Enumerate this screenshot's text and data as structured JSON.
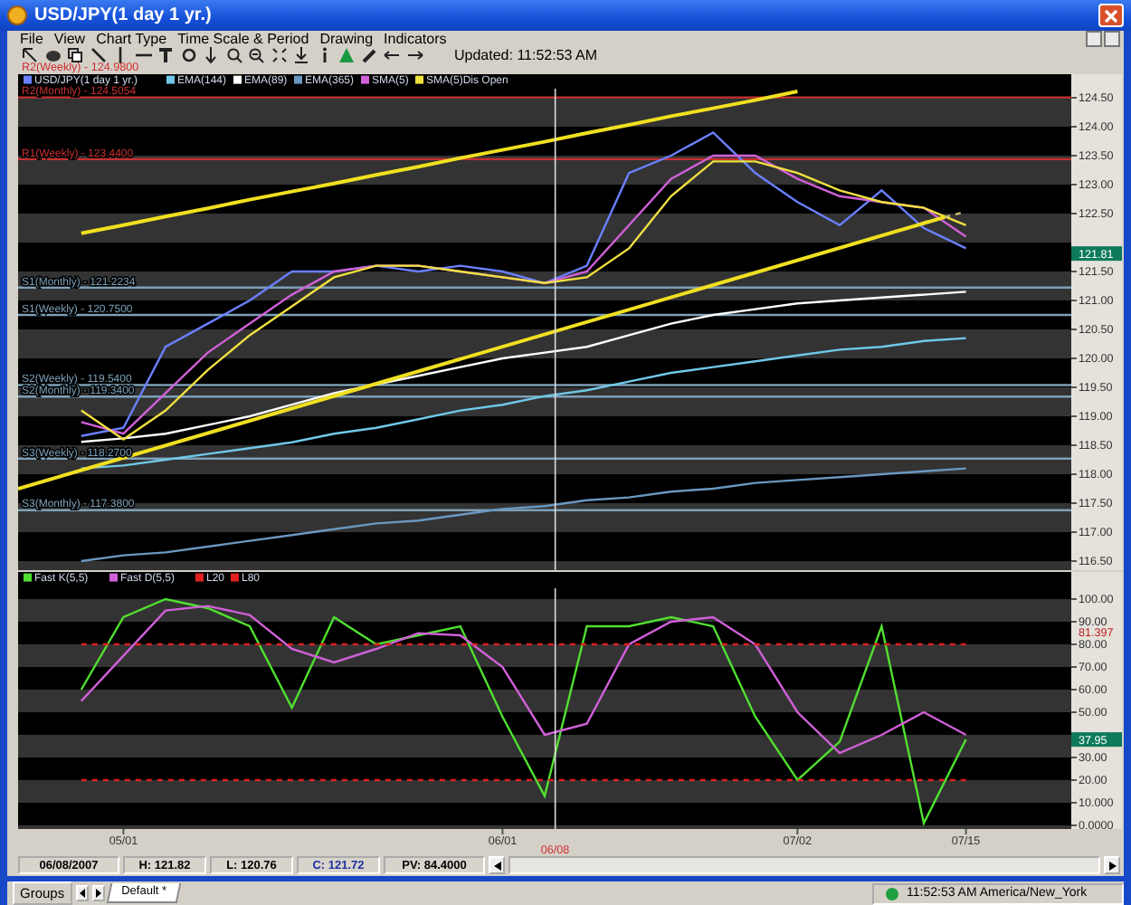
{
  "window": {
    "title": "USD/JPY(1 day  1 yr.)"
  },
  "menu": [
    "File",
    "View",
    "Chart Type",
    "Time Scale & Period",
    "Drawing",
    "Indicators"
  ],
  "toolbar": {
    "updated": "Updated: 11:52:53 AM"
  },
  "top_label": "R2(Weekly) - 124.9800",
  "cursor_date": "06/08",
  "price_chart": {
    "chart_data": {
      "type": "line",
      "legend": "upper left",
      "ylim": [
        116.344,
        124.906
      ],
      "categories": [
        null,
        null,
        null,
        null,
        null,
        null,
        null,
        null,
        null,
        null,
        null,
        null,
        null,
        null,
        null,
        null,
        null,
        null,
        null,
        null,
        null,
        null
      ],
      "yticks": [
        {
          "value": 124.5,
          "label": "124.50"
        },
        {
          "value": 124,
          "label": "124.00"
        },
        {
          "value": 123.5,
          "label": "123.50"
        },
        {
          "value": 123,
          "label": "123.00"
        },
        {
          "value": 122.5,
          "label": "122.50"
        },
        {
          "value": 121.5,
          "label": "121.50"
        },
        {
          "value": 121,
          "label": "121.00"
        },
        {
          "value": 120.5,
          "label": "120.50"
        },
        {
          "value": 120,
          "label": "120.00"
        },
        {
          "value": 119.5,
          "label": "119.50"
        },
        {
          "value": 119,
          "label": "119.00"
        },
        {
          "value": 118.5,
          "label": "118.50"
        },
        {
          "value": 118,
          "label": "118.00"
        },
        {
          "value": 117.5,
          "label": "117.50"
        },
        {
          "value": 117,
          "label": "117.00"
        },
        {
          "value": 116.5,
          "label": "116.50"
        }
      ],
      "series": [
        {
          "name": "USD/JPY(1 day 1 yr.)",
          "color": "#6a80ff",
          "values": [
            118.66,
            118.8,
            120.2,
            120.6,
            121.0,
            121.5,
            121.5,
            121.6,
            121.5,
            121.6,
            121.5,
            121.3,
            121.6,
            123.2,
            123.5,
            123.9,
            123.2,
            122.7,
            122.3,
            122.9,
            122.25,
            121.9
          ]
        },
        {
          "name": "EMA(144)",
          "color": "#70c8e8",
          "values": [
            118.1,
            118.15,
            118.25,
            118.35,
            118.45,
            118.55,
            118.7,
            118.8,
            118.95,
            119.1,
            119.2,
            119.35,
            119.45,
            119.6,
            119.75,
            119.85,
            119.95,
            120.05,
            120.15,
            120.2,
            120.3,
            120.35
          ]
        },
        {
          "name": "EMA(89)",
          "color": "#ffffff",
          "values": [
            118.56,
            118.62,
            118.7,
            118.85,
            119.0,
            119.2,
            119.4,
            119.55,
            119.7,
            119.85,
            120.0,
            120.1,
            120.2,
            120.4,
            120.6,
            120.75,
            120.85,
            120.95,
            121.0,
            121.05,
            121.1,
            121.15
          ]
        },
        {
          "name": "EMA(365)",
          "color": "#6a98c0",
          "values": [
            116.5,
            116.6,
            116.65,
            116.75,
            116.85,
            116.95,
            117.05,
            117.15,
            117.2,
            117.3,
            117.4,
            117.45,
            117.55,
            117.6,
            117.7,
            117.75,
            117.85,
            117.9,
            117.95,
            118.0,
            118.05,
            118.1
          ]
        },
        {
          "name": "SMA(5)",
          "color": "#d060d8",
          "values": [
            118.9,
            118.7,
            119.4,
            120.1,
            120.6,
            121.1,
            121.5,
            121.6,
            121.6,
            121.5,
            121.4,
            121.3,
            121.5,
            122.3,
            123.1,
            123.5,
            123.5,
            123.1,
            122.8,
            122.7,
            122.6,
            122.1
          ]
        },
        {
          "name": "SMA(5)Dis Open",
          "color": "#f0e040",
          "values": [
            119.1,
            118.6,
            119.1,
            119.8,
            120.4,
            120.9,
            121.4,
            121.6,
            121.6,
            121.5,
            121.4,
            121.3,
            121.4,
            121.9,
            122.8,
            123.4,
            123.4,
            123.2,
            122.9,
            122.7,
            122.6,
            122.3
          ]
        },
        {
          "color": "#f0e020",
          "values": [
            122.16,
            122.3,
            122.45,
            122.59,
            122.74,
            122.88,
            123.02,
            123.17,
            123.31,
            123.46,
            123.6,
            123.74,
            123.89,
            124.03,
            124.18,
            124.32,
            124.46,
            124.61,
            null,
            null,
            null,
            null
          ]
        },
        {
          "color": "#c8c070",
          "line_style": "dashed",
          "values": [
            null,
            null,
            null,
            null,
            null,
            null,
            null,
            null,
            null,
            null,
            null,
            null,
            null,
            null,
            null,
            null,
            null,
            null,
            null,
            null,
            122.35,
            122.53
          ]
        }
      ],
      "ref_lines": [
        {
          "axis": "y",
          "value": 124.5054,
          "label": "R2(Monthly) - 124.5054",
          "color": "#c83030"
        },
        {
          "axis": "y",
          "value": 123.44,
          "label": "R1(Weekly) - 123.4400",
          "color": "#c83030"
        },
        {
          "axis": "y",
          "value": 121.2234,
          "label": "S1(Monthly) - 121.2234",
          "color": "#7ea0b8"
        },
        {
          "axis": "y",
          "value": 120.75,
          "label": "S1(Weekly) - 120.7500",
          "color": "#7ea0b8"
        },
        {
          "axis": "y",
          "value": 119.54,
          "label": "S2(Weekly) - 119.5400",
          "color": "#7ea0b8"
        },
        {
          "axis": "y",
          "value": 119.34,
          "label": "S2(Monthly) - 119.3400",
          "color": "#7ea0b8"
        },
        {
          "axis": "y",
          "value": 118.27,
          "label": "S3(Weekly) - 118.2700",
          "color": "#7ea0b8"
        },
        {
          "axis": "y",
          "value": 117.38,
          "label": "S3(Monthly) - 117.3800",
          "color": "#7ea0b8"
        }
      ]
    },
    "tags": [
      {
        "text": "121.81",
        "kind": "filled"
      }
    ]
  },
  "oscillator": {
    "chart_data": {
      "type": "line",
      "legend": "upper left",
      "ylim": [
        -1.6,
        112
      ],
      "categories": [
        null,
        "05/01",
        null,
        null,
        null,
        null,
        null,
        null,
        null,
        null,
        "06/01",
        null,
        null,
        null,
        null,
        null,
        null,
        "07/02",
        null,
        null,
        null,
        "07/15"
      ],
      "yticks": [
        {
          "value": 100,
          "label": "100.00"
        },
        {
          "value": 90,
          "label": "90.00"
        },
        {
          "value": 80,
          "label": "80.00"
        },
        {
          "value": 70,
          "label": "70.00"
        },
        {
          "value": 60,
          "label": "60.00"
        },
        {
          "value": 50,
          "label": "50.00"
        },
        {
          "value": 30,
          "label": "30.00"
        },
        {
          "value": 20,
          "label": "20.00"
        },
        {
          "value": 10,
          "label": "10.000"
        },
        {
          "value": 0,
          "label": "0.0000"
        }
      ],
      "series": [
        {
          "name": "Fast K(5,5)",
          "color": "#50e030",
          "values": [
            60,
            92,
            100,
            96,
            88,
            52,
            92,
            80,
            84,
            88,
            48,
            13,
            88,
            88,
            92,
            88,
            48,
            20,
            37,
            88,
            1,
            38
          ]
        },
        {
          "name": "Fast D(5,5)",
          "color": "#d060d8",
          "values": [
            55,
            75,
            95,
            97,
            93,
            78,
            72,
            78,
            85,
            84,
            70,
            40,
            45,
            80,
            90,
            92,
            80,
            50,
            32,
            40,
            50,
            40
          ]
        },
        {
          "name": "L20",
          "color": "#e02020",
          "line_style": "dashed",
          "values": [
            20,
            20,
            20,
            20,
            20,
            20,
            20,
            20,
            20,
            20,
            20,
            20,
            20,
            20,
            20,
            20,
            20,
            20,
            20,
            20,
            20,
            20
          ]
        },
        {
          "name": "L80",
          "color": "#e02020",
          "line_style": "dashed",
          "values": [
            80,
            80,
            80,
            80,
            80,
            80,
            80,
            80,
            80,
            80,
            80,
            80,
            80,
            80,
            80,
            80,
            80,
            80,
            80,
            80,
            80,
            80
          ]
        }
      ]
    },
    "tags": [
      {
        "text": "81.397",
        "kind": "outline"
      },
      {
        "text": "37.95",
        "kind": "filled"
      }
    ]
  },
  "status_bar": [
    "06/08/2007",
    "H: 121.82",
    "L: 120.76",
    "C: 121.72",
    "PV: 84.4000"
  ],
  "taskbar": {
    "groups": "Groups",
    "tabs": [
      {
        "label": "Default *",
        "selected": true
      }
    ],
    "clock": "11:52:53 AM America/New_York"
  }
}
